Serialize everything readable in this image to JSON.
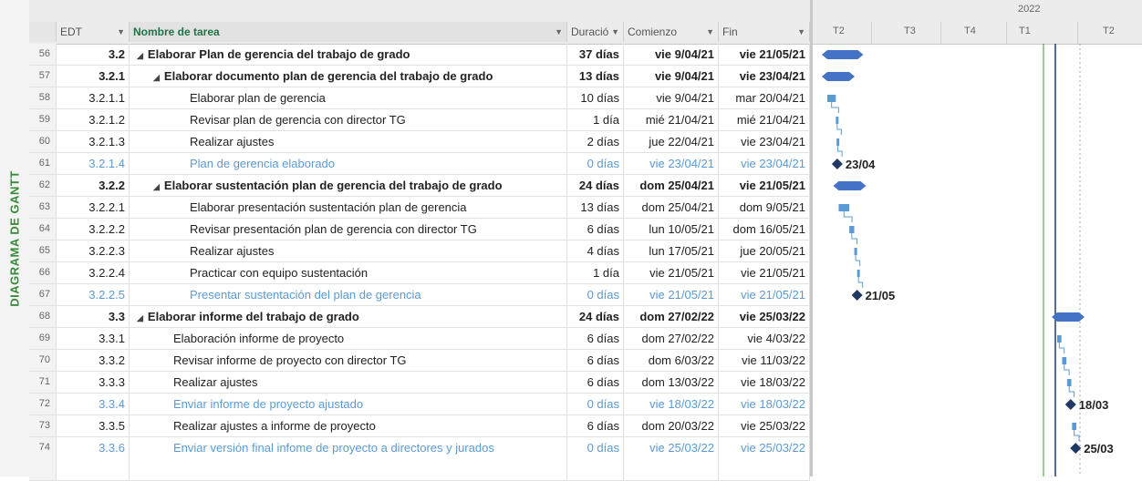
{
  "view_label": "DIAGRAMA DE GANTT",
  "columns": {
    "wbs": "EDT",
    "name": "Nombre de tarea",
    "duration": "Duració",
    "start": "Comienzo",
    "finish": "Fin"
  },
  "timescale": {
    "year": "2022",
    "quarters": [
      "T2",
      "T3",
      "T4",
      "T1",
      "T2"
    ]
  },
  "colors": {
    "accent": "#217346",
    "bar": "#4472c4",
    "milestone_text": "#5b9bd5",
    "today_line": "#3a9a3a"
  },
  "tasks": [
    {
      "id": "56",
      "wbs": "3.2",
      "name": "Elaborar Plan de gerencia del trabajo de grado",
      "duration": "37 días",
      "start": "vie 9/04/21",
      "finish": "vie 21/05/21",
      "type": "summary",
      "indent": 0
    },
    {
      "id": "57",
      "wbs": "3.2.1",
      "name": "Elaborar documento plan de gerencia del trabajo de grado",
      "duration": "13 días",
      "start": "vie 9/04/21",
      "finish": "vie 23/04/21",
      "type": "summary",
      "indent": 1
    },
    {
      "id": "58",
      "wbs": "3.2.1.1",
      "name": "Elaborar plan de gerencia",
      "duration": "10 días",
      "start": "vie 9/04/21",
      "finish": "mar 20/04/21",
      "type": "task",
      "indent": 2
    },
    {
      "id": "59",
      "wbs": "3.2.1.2",
      "name": "Revisar plan de gerencia con director TG",
      "duration": "1 día",
      "start": "mié 21/04/21",
      "finish": "mié 21/04/21",
      "type": "task",
      "indent": 2
    },
    {
      "id": "60",
      "wbs": "3.2.1.3",
      "name": "Realizar ajustes",
      "duration": "2 días",
      "start": "jue 22/04/21",
      "finish": "vie 23/04/21",
      "type": "task",
      "indent": 2
    },
    {
      "id": "61",
      "wbs": "3.2.1.4",
      "name": "Plan de gerencia elaborado",
      "duration": "0 días",
      "start": "vie 23/04/21",
      "finish": "vie 23/04/21",
      "type": "milestone",
      "indent": 2,
      "label": "23/04"
    },
    {
      "id": "62",
      "wbs": "3.2.2",
      "name": "Elaborar sustentación plan de gerencia del trabajo de grado",
      "duration": "24 días",
      "start": "dom 25/04/21",
      "finish": "vie 21/05/21",
      "type": "summary",
      "indent": 1
    },
    {
      "id": "63",
      "wbs": "3.2.2.1",
      "name": "Elaborar presentación sustentación plan de gerencia",
      "duration": "13 días",
      "start": "dom 25/04/21",
      "finish": "dom 9/05/21",
      "type": "task",
      "indent": 2
    },
    {
      "id": "64",
      "wbs": "3.2.2.2",
      "name": "Revisar presentación plan de gerencia con director TG",
      "duration": "6 días",
      "start": "lun 10/05/21",
      "finish": "dom 16/05/21",
      "type": "task",
      "indent": 2
    },
    {
      "id": "65",
      "wbs": "3.2.2.3",
      "name": "Realizar ajustes",
      "duration": "4 días",
      "start": "lun 17/05/21",
      "finish": "jue 20/05/21",
      "type": "task",
      "indent": 2
    },
    {
      "id": "66",
      "wbs": "3.2.2.4",
      "name": "Practicar con equipo sustentación",
      "duration": "1 día",
      "start": "vie 21/05/21",
      "finish": "vie 21/05/21",
      "type": "task",
      "indent": 2
    },
    {
      "id": "67",
      "wbs": "3.2.2.5",
      "name": "Presentar sustentación del plan de gerencia",
      "duration": "0 días",
      "start": "vie 21/05/21",
      "finish": "vie 21/05/21",
      "type": "milestone",
      "indent": 2,
      "label": "21/05"
    },
    {
      "id": "68",
      "wbs": "3.3",
      "name": "Elaborar informe del trabajo de grado",
      "duration": "24 días",
      "start": "dom 27/02/22",
      "finish": "vie 25/03/22",
      "type": "summary",
      "indent": 0
    },
    {
      "id": "69",
      "wbs": "3.3.1",
      "name": "Elaboración informe de proyecto",
      "duration": "6 días",
      "start": "dom 27/02/22",
      "finish": "vie 4/03/22",
      "type": "task",
      "indent": 1
    },
    {
      "id": "70",
      "wbs": "3.3.2",
      "name": "Revisar informe de proyecto con director TG",
      "duration": "6 días",
      "start": "dom 6/03/22",
      "finish": "vie 11/03/22",
      "type": "task",
      "indent": 1
    },
    {
      "id": "71",
      "wbs": "3.3.3",
      "name": "Realizar ajustes",
      "duration": "6 días",
      "start": "dom 13/03/22",
      "finish": "vie 18/03/22",
      "type": "task",
      "indent": 1
    },
    {
      "id": "72",
      "wbs": "3.3.4",
      "name": "Enviar informe de proyecto ajustado",
      "duration": "0 días",
      "start": "vie 18/03/22",
      "finish": "vie 18/03/22",
      "type": "milestone",
      "indent": 1,
      "label": "18/03"
    },
    {
      "id": "73",
      "wbs": "3.3.5",
      "name": "Realizar ajustes a informe de proyecto",
      "duration": "6 días",
      "start": "dom 20/03/22",
      "finish": "vie 25/03/22",
      "type": "task",
      "indent": 1
    },
    {
      "id": "74",
      "wbs": "3.3.6",
      "name": "Enviar versión final infome de proyecto a directores y jurados",
      "duration": "0 días",
      "start": "vie 25/03/22",
      "finish": "vie 25/03/22",
      "type": "milestone",
      "indent": 1,
      "label": "25/03"
    }
  ]
}
